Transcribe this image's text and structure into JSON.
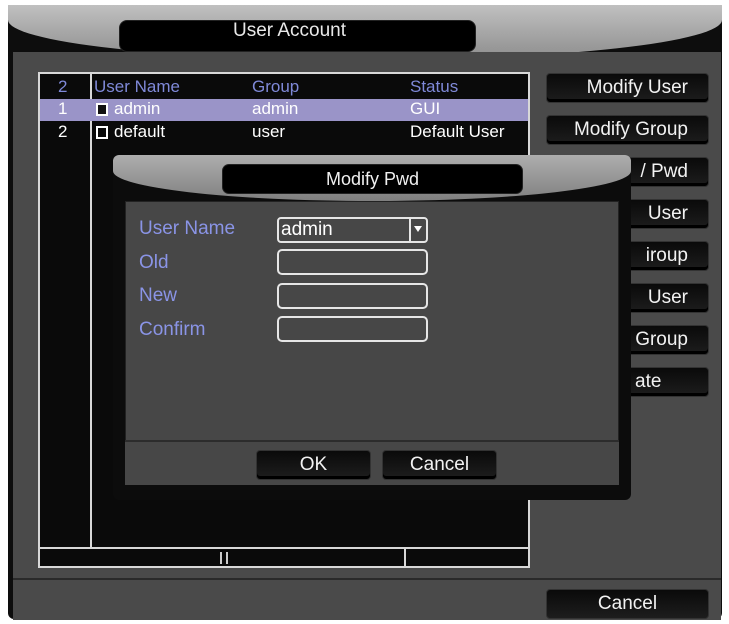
{
  "window": {
    "title": "User Account"
  },
  "table": {
    "headers": {
      "count": "2",
      "user_name": "User Name",
      "group": "Group",
      "status": "Status"
    },
    "rows": [
      {
        "num": "1",
        "user_name": "admin",
        "group": "admin",
        "status": "GUI",
        "selected": true
      },
      {
        "num": "2",
        "user_name": "default",
        "group": "user",
        "status": "Default User",
        "selected": false
      }
    ]
  },
  "side_buttons": {
    "modify_user": "Modify User",
    "modify_group": "Modify Group",
    "modify_pwd": "/ Pwd",
    "add_user": "User",
    "add_group": "iroup",
    "delete_user": "User",
    "delete_group": "Group",
    "update": "ate"
  },
  "footer": {
    "cancel_label": "Cancel"
  },
  "dialog": {
    "title": "Modify Pwd",
    "fields": {
      "user_name_label": "User Name",
      "user_name_value": "admin",
      "old_label": "Old",
      "new_label": "New",
      "confirm_label": "Confirm"
    },
    "ok_label": "OK",
    "cancel_label": "Cancel"
  }
}
